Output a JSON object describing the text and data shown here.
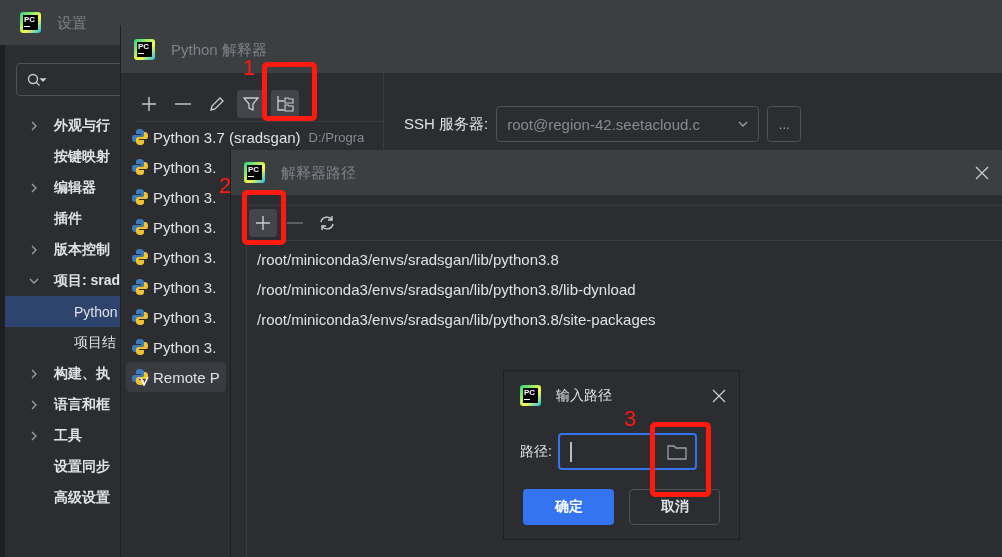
{
  "settings": {
    "logo": "PC",
    "title": "设置",
    "tree": [
      {
        "label": "外观与行",
        "kind": "group",
        "expanded": false,
        "selected": false
      },
      {
        "label": "按键映射",
        "kind": "leaf",
        "selected": false
      },
      {
        "label": "编辑器",
        "kind": "group",
        "expanded": false,
        "selected": false
      },
      {
        "label": "插件",
        "kind": "leaf",
        "selected": false
      },
      {
        "label": "版本控制",
        "kind": "group",
        "expanded": false,
        "selected": false
      },
      {
        "label": "项目: srad",
        "kind": "group",
        "expanded": true,
        "selected": false,
        "children": [
          {
            "label": "Python",
            "selected": true
          },
          {
            "label": "项目结",
            "selected": false
          }
        ]
      },
      {
        "label": "构建、执",
        "kind": "group",
        "expanded": false,
        "selected": false
      },
      {
        "label": "语言和框",
        "kind": "group",
        "expanded": false,
        "selected": false
      },
      {
        "label": "工具",
        "kind": "group",
        "expanded": false,
        "selected": false
      },
      {
        "label": "设置同步",
        "kind": "leaf",
        "selected": false
      },
      {
        "label": "高级设置",
        "kind": "leaf",
        "selected": false
      }
    ]
  },
  "interpreters_dialog": {
    "logo": "PC",
    "title": "Python 解释器",
    "toolbar": [
      {
        "kind": "add",
        "selected": false
      },
      {
        "kind": "remove",
        "selected": false
      },
      {
        "kind": "edit",
        "selected": false
      },
      {
        "kind": "filter",
        "selected": true
      },
      {
        "kind": "paths",
        "selected": true
      }
    ],
    "interpreters": [
      {
        "name": "Python 3.7 (sradsgan)",
        "path": "D:/Progra",
        "kind": "local",
        "selected": false
      },
      {
        "name": "Python 3.",
        "kind": "local",
        "selected": false
      },
      {
        "name": "Python 3.",
        "kind": "local",
        "selected": false
      },
      {
        "name": "Python 3.",
        "kind": "local",
        "selected": false
      },
      {
        "name": "Python 3.",
        "kind": "local",
        "selected": false
      },
      {
        "name": "Python 3.",
        "kind": "local",
        "selected": false
      },
      {
        "name": "Python 3.",
        "kind": "local",
        "selected": false
      },
      {
        "name": "Python 3.",
        "kind": "local",
        "selected": false
      },
      {
        "name": "Remote P",
        "kind": "remote",
        "selected": true
      }
    ],
    "ssh_label": "SSH 服务器:",
    "ssh_server": "root@region-42.seetacloud.c",
    "more_button": "..."
  },
  "paths_dialog": {
    "logo": "PC",
    "title": "解释器路径",
    "toolbar": [
      {
        "kind": "add",
        "disabled": false
      },
      {
        "kind": "remove",
        "disabled": true
      },
      {
        "kind": "refresh",
        "disabled": false
      }
    ],
    "paths": [
      "/root/miniconda3/envs/sradsgan/lib/python3.8",
      "/root/miniconda3/envs/sradsgan/lib/python3.8/lib-dynload",
      "/root/miniconda3/envs/sradsgan/lib/python3.8/site-packages"
    ]
  },
  "input_dialog": {
    "logo": "PC",
    "title": "输入路径",
    "label": "路径:",
    "focused": true,
    "buttons": [
      {
        "label": "确定",
        "primary": true
      },
      {
        "label": "取消",
        "primary": false
      }
    ]
  },
  "annotations": [
    {
      "label": "1"
    },
    {
      "label": "2"
    },
    {
      "label": "3"
    }
  ]
}
